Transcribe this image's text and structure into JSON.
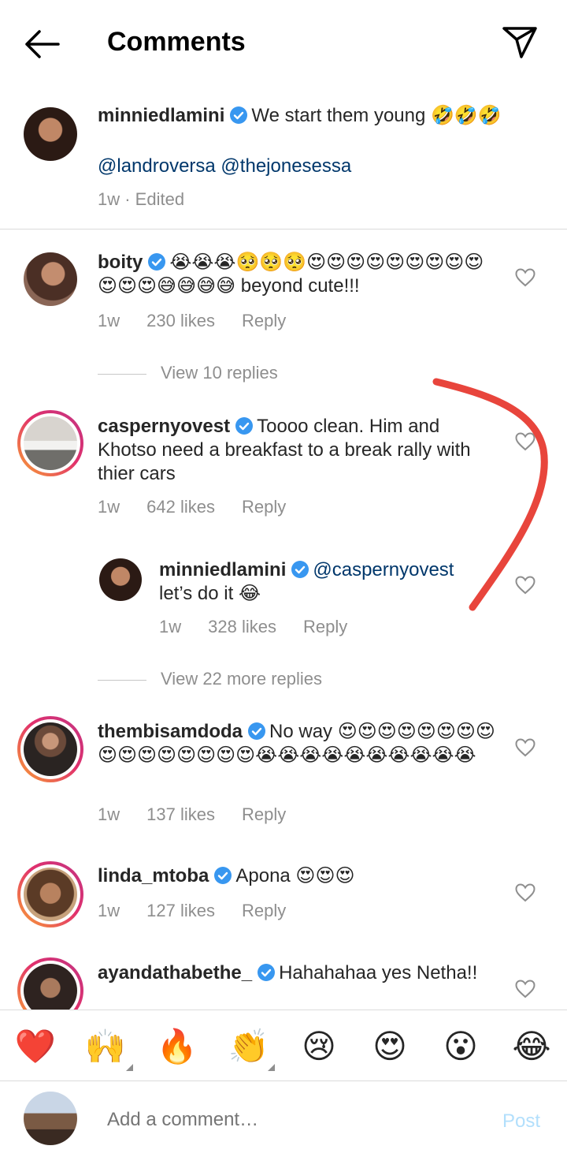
{
  "header": {
    "title": "Comments"
  },
  "caption": {
    "username": "minniedlamini",
    "text": "We start them young 🤣🤣🤣",
    "mentions": "@landroversa @thejonesessa",
    "meta": "1w · Edited"
  },
  "comments": [
    {
      "username": "boity",
      "text": "😭😭😭🥺🥺🥺😍😍😍😍😍😍😍😍😍😍😍😍😅😅😅😅 beyond cute!!!",
      "time": "1w",
      "likes": "230 likes",
      "reply": "Reply",
      "view_replies": "View 10 replies"
    },
    {
      "username": "caspernyovest",
      "text": "Toooo clean. Him and Khotso need a breakfast to a break rally with thier cars",
      "time": "1w",
      "likes": "642 likes",
      "reply": "Reply"
    },
    {
      "username": "minniedlamini",
      "mention": "@caspernyovest",
      "text": "let’s do it 😂",
      "time": "1w",
      "likes": "328 likes",
      "reply": "Reply",
      "view_replies": "View 22 more replies"
    },
    {
      "username": "thembisamdoda",
      "text": "No way 😍😍😍😍😍😍😍😍😍😍😍😍😍😍😍😍😭😭😭😭😭😭😭😭😭😭",
      "time": "1w",
      "likes": "137 likes",
      "reply": "Reply"
    },
    {
      "username": "linda_mtoba",
      "text": "Apona 😍😍😍",
      "time": "1w",
      "likes": "127 likes",
      "reply": "Reply"
    },
    {
      "username": "ayandathabethe_",
      "text": "Hahahahaa yes Netha!!"
    }
  ],
  "emoji_bar": [
    "❤️",
    "🙌",
    "🔥",
    "👏",
    "😢",
    "😍",
    "😮",
    "😂"
  ],
  "input": {
    "placeholder": "Add a comment…",
    "post_label": "Post"
  },
  "colors": {
    "verified": "#3897f0",
    "annotation": "#e8453c",
    "post": "#b2dffc"
  }
}
